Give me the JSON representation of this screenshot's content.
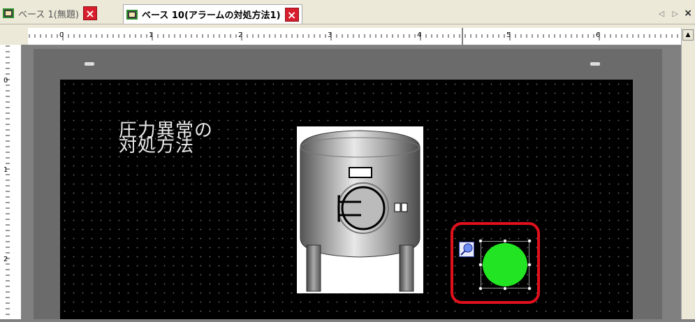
{
  "tabs": [
    {
      "label": "ベース 1(無題)",
      "active": false
    },
    {
      "label": "ベース 10(アラームの対処方法1)",
      "active": true
    }
  ],
  "tab_close_glyph": "×",
  "nav_arrows": "◁ ▷",
  "window_close_glyph": "×",
  "ruler": {
    "h_labels": [
      "0",
      "1",
      "2",
      "3",
      "4",
      "5",
      "6"
    ],
    "v_labels": [
      "0",
      "1",
      "2"
    ]
  },
  "screen": {
    "title_text": "圧力異常の\n対処方法",
    "lamp_color": "#22e422"
  },
  "colors": {
    "highlight": "#e0101c",
    "close_button": "#d81e2c"
  }
}
